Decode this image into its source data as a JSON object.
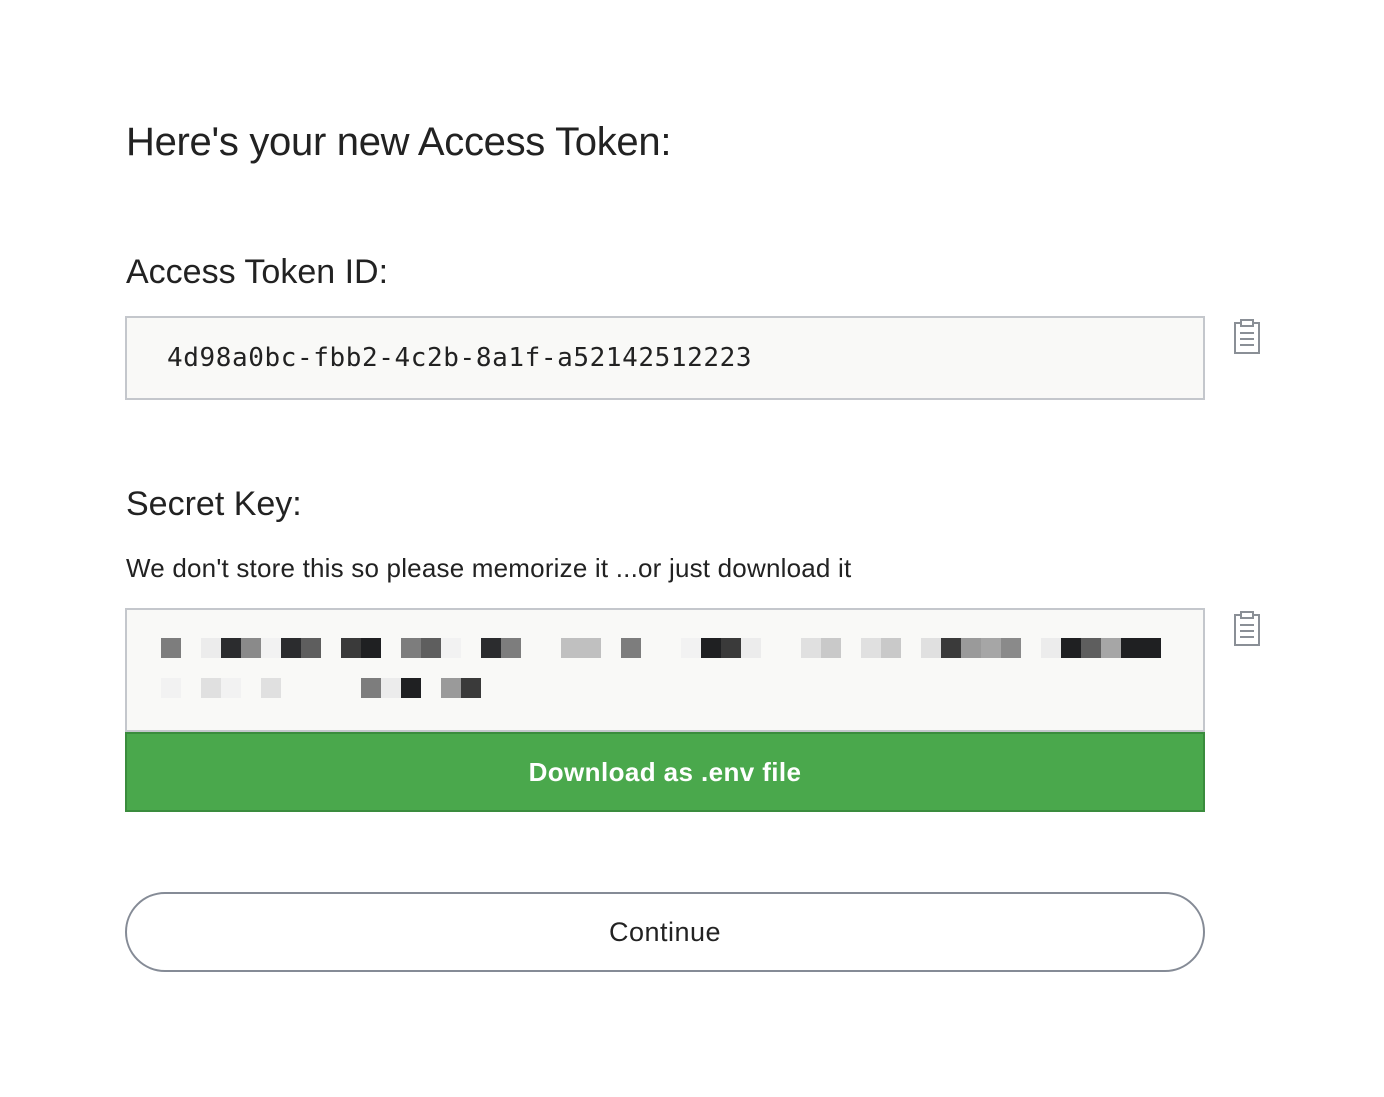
{
  "page": {
    "title": "Here's your new Access Token:"
  },
  "token": {
    "label": "Access Token ID:",
    "value": "4d98a0bc-fbb2-4c2b-8a1f-a52142512223",
    "copy_icon": "clipboard-icon"
  },
  "secret": {
    "label": "Secret Key:",
    "hint": "We don't store this so please memorize it ...or just download it",
    "copy_icon": "clipboard-icon",
    "pixelated": true
  },
  "actions": {
    "download_label": "Download as .env file",
    "continue_label": "Continue"
  },
  "colors": {
    "download_bg": "#4aa84c",
    "field_bg": "#f9f9f7",
    "field_border": "#c4c7cc",
    "continue_border": "#858b96"
  }
}
